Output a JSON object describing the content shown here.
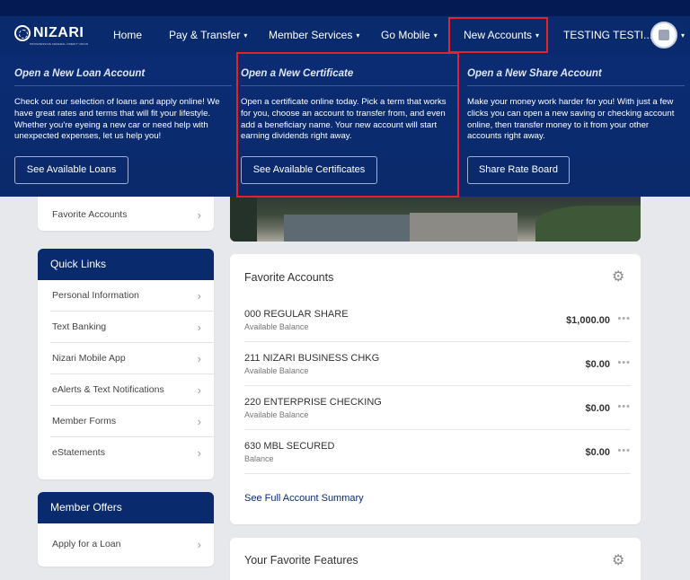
{
  "header": {
    "brand": "NIZARI",
    "brand_sub": "PROGRESSIVE FEDERAL CREDIT UNION",
    "nav": [
      {
        "label": "Home",
        "has_caret": false
      },
      {
        "label": "Pay & Transfer",
        "has_caret": true
      },
      {
        "label": "Member Services",
        "has_caret": true
      },
      {
        "label": "Go Mobile",
        "has_caret": true
      },
      {
        "label": "New Accounts",
        "has_caret": true,
        "highlighted": true
      },
      {
        "label": "TESTING TESTI...",
        "has_caret": false
      }
    ],
    "caret": "▾"
  },
  "mega_menu": {
    "loan": {
      "title": "Open a New Loan Account",
      "text": "Check out our selection of loans and apply online! We have great rates and terms that will fit your lifestyle. Whether you're eyeing a new car or need help with unexpected expenses, let us help you!",
      "button": "See Available Loans"
    },
    "certificate": {
      "title": "Open a New Certificate",
      "text": "Open a certificate online today. Pick a term that works for you, choose an account to transfer from, and even add a beneficiary name. Your new account will start earning dividends right away.",
      "button": "See Available Certificates"
    },
    "share": {
      "title": "Open a New Share Account",
      "text": "Make your money work harder for you! With just a few clicks you can open a new saving or checking account online, then transfer money to it from your other accounts right away.",
      "button": "Share Rate Board"
    }
  },
  "sidebar": {
    "top_card": {
      "items": [
        "Favorite Accounts"
      ]
    },
    "quick_links": {
      "title": "Quick Links",
      "items": [
        "Personal Information",
        "Text Banking",
        "Nizari Mobile App",
        "eAlerts & Text Notifications",
        "Member Forms",
        "eStatements"
      ]
    },
    "member_offers": {
      "title": "Member Offers",
      "items": [
        "Apply for a Loan"
      ]
    },
    "chevron": "›"
  },
  "favorite_accounts": {
    "title": "Favorite Accounts",
    "accounts": [
      {
        "name": "000 REGULAR SHARE",
        "label": "Available Balance",
        "amount": "$1,000.00"
      },
      {
        "name": "211 NIZARI BUSINESS CHKG",
        "label": "Available Balance",
        "amount": "$0.00"
      },
      {
        "name": "220 ENTERPRISE CHECKING",
        "label": "Available Balance",
        "amount": "$0.00"
      },
      {
        "name": "630 MBL SECURED",
        "label": "Balance",
        "amount": "$0.00"
      }
    ],
    "more": "•••",
    "summary_link": "See Full Account Summary"
  },
  "favorite_features": {
    "title": "Your Favorite Features"
  },
  "icons": {
    "gear": "⚙",
    "colors": {
      "navy": "#0a2a6e",
      "highlight_red": "#e3222b"
    }
  }
}
